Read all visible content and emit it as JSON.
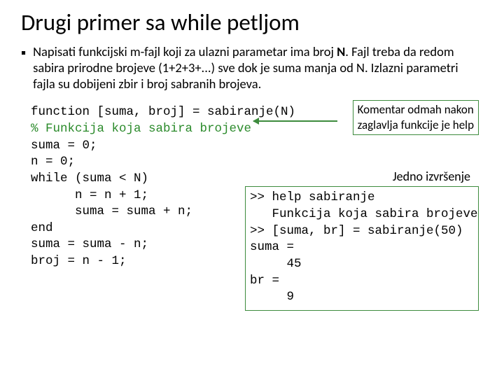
{
  "title": "Drugi primer sa while petljom",
  "bullet": "▪",
  "paragraph": {
    "p1": "Napisati funkcijski m-fajl koji za ulazni parametar ima broj ",
    "bold": "N",
    "p2": ". Fajl treba da redom sabira prirodne brojeve (1+2+3+...) sve dok je suma manja od N. Izlazni parametri fajla su dobijeni zbir i broj sabranih brojeva."
  },
  "code": {
    "l1": "function [suma, broj] = sabiranje(N)",
    "l2": "% Funkcija koja sabira brojeve",
    "l3": "suma = 0;",
    "l4": "n = 0;",
    "l5": "while (suma < N)",
    "l6": "      n = n + 1;",
    "l7": "      suma = suma + n;",
    "l8": "end",
    "l9": "suma = suma - n;",
    "l10": "broj = n - 1;"
  },
  "helpbox": {
    "l1": "Komentar odmah nakon",
    "l2": "zaglavlja funkcije je help"
  },
  "execlabel": "Jedno izvršenje",
  "output": {
    "l1": ">> help sabiranje",
    "l2": "   Funkcija koja sabira brojeve",
    "l3": ">> [suma, br] = sabiranje(50)",
    "l4": "suma =",
    "l5": "     45",
    "l6": "br =",
    "l7": "     9"
  }
}
